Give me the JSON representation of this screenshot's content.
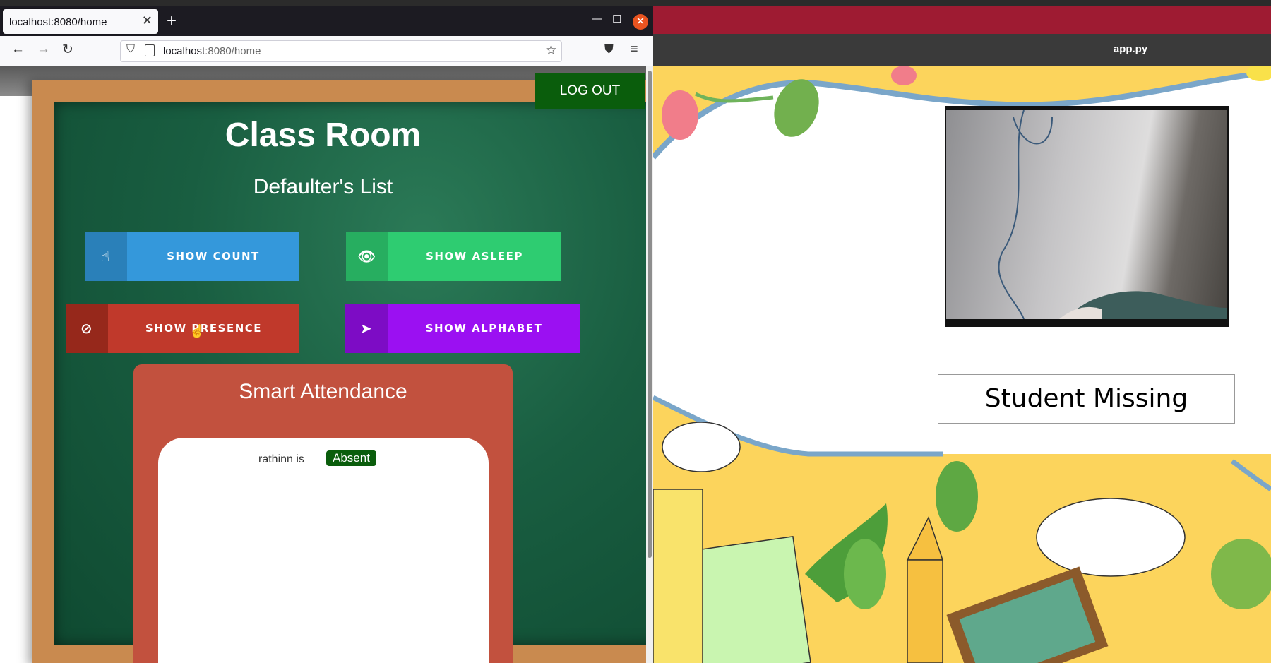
{
  "browser": {
    "tab_title": "localhost:8080/home",
    "new_tab": "+",
    "url_host": "localhost",
    "url_path": ":8080/home"
  },
  "page": {
    "logout_label": "LOG OUT",
    "title": "Class Room",
    "subtitle": "Defaulter's List",
    "buttons": [
      {
        "label": "SHOW COUNT",
        "icon": "pointer-hand-icon",
        "color": "#3498db"
      },
      {
        "label": "SHOW ASLEEP",
        "icon": "eye-icon",
        "color": "#2ecc71"
      },
      {
        "label": "SHOW PRESENCE",
        "icon": "eye-slash-icon",
        "color": "#c0392b"
      },
      {
        "label": "SHOW ALPHABET",
        "icon": "paper-plane-icon",
        "color": "#9b10f2"
      }
    ],
    "attendance": {
      "title": "Smart Attendance",
      "rows": [
        {
          "text": "rathinn is",
          "status": "Absent"
        }
      ]
    }
  },
  "app": {
    "window_title": "app.py",
    "status": "Student Missing"
  }
}
